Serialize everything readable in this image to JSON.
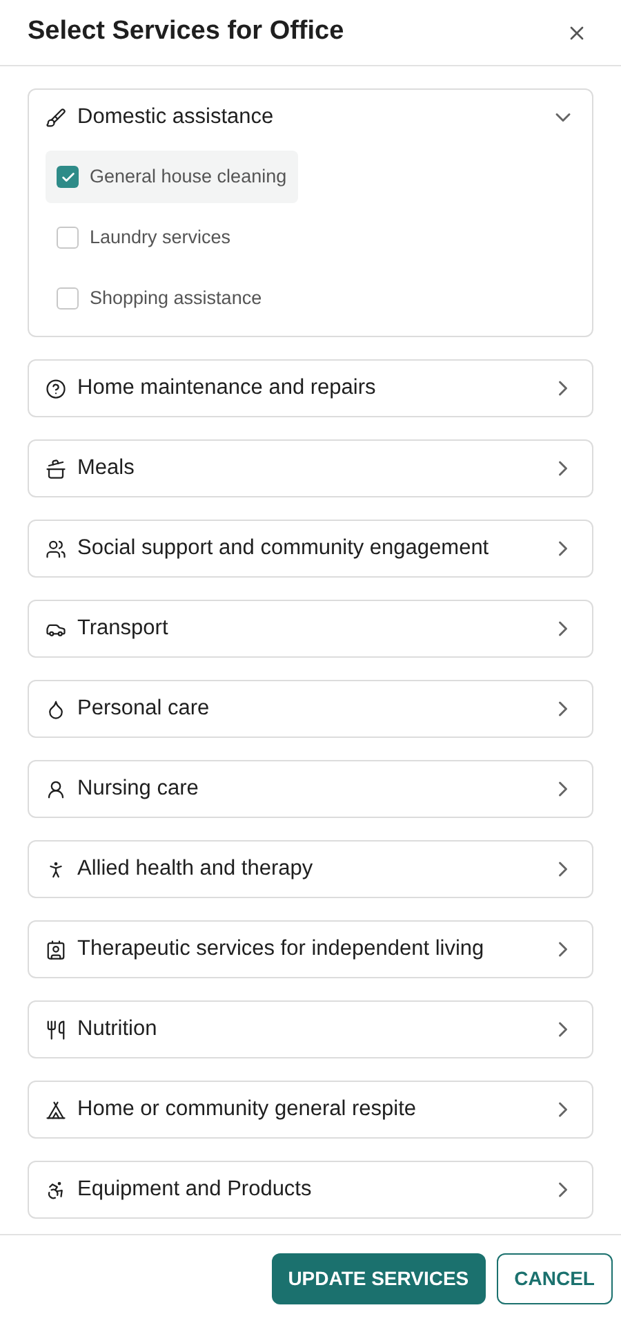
{
  "dialog": {
    "title": "Select Services for Office"
  },
  "categories": [
    {
      "name": "Domestic assistance",
      "expanded": true,
      "items": [
        {
          "label": "General house cleaning",
          "checked": true
        },
        {
          "label": "Laundry services",
          "checked": false
        },
        {
          "label": "Shopping assistance",
          "checked": false
        }
      ]
    },
    {
      "name": "Home maintenance and repairs",
      "expanded": false
    },
    {
      "name": "Meals",
      "expanded": false
    },
    {
      "name": "Social support and community engagement",
      "expanded": false
    },
    {
      "name": "Transport",
      "expanded": false
    },
    {
      "name": "Personal care",
      "expanded": false
    },
    {
      "name": "Nursing care",
      "expanded": false
    },
    {
      "name": "Allied health and therapy",
      "expanded": false
    },
    {
      "name": "Therapeutic services for independent living",
      "expanded": false
    },
    {
      "name": "Nutrition",
      "expanded": false
    },
    {
      "name": "Home or community general respite",
      "expanded": false
    },
    {
      "name": "Equipment and Products",
      "expanded": false
    }
  ],
  "buttons": {
    "primary": "UPDATE SERVICES",
    "secondary": "CANCEL"
  }
}
